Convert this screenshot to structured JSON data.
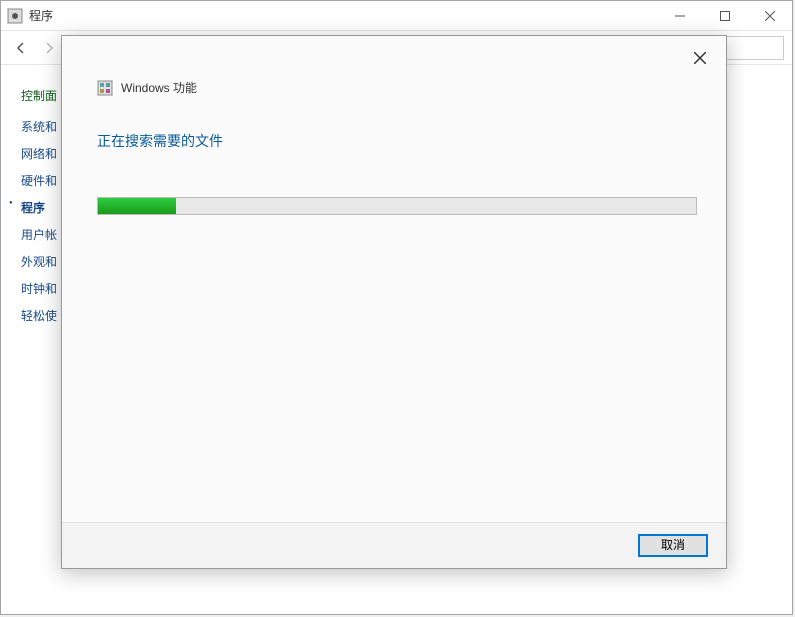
{
  "window": {
    "title": "程序"
  },
  "sidebar": {
    "heading": "控制面",
    "items": [
      {
        "label": "系统和"
      },
      {
        "label": "网络和"
      },
      {
        "label": "硬件和"
      },
      {
        "label": "程序",
        "current": true
      },
      {
        "label": "用户帐"
      },
      {
        "label": "外观和"
      },
      {
        "label": "时钟和"
      },
      {
        "label": "轻松使"
      }
    ]
  },
  "dialog": {
    "title": "Windows 功能",
    "subtitle": "正在搜索需要的文件",
    "progress_percent": 13,
    "cancel_label": "取消"
  }
}
